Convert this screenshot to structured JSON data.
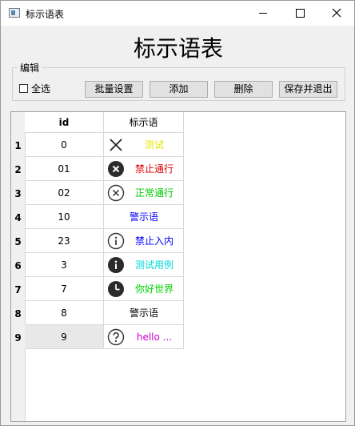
{
  "window": {
    "title": "标示语表",
    "controls": {
      "minimize": "minimize",
      "maximize": "maximize",
      "close": "close"
    }
  },
  "heading": "标示语表",
  "edit_group": {
    "title": "编辑",
    "select_all_label": "全选",
    "select_all_checked": false,
    "buttons": {
      "batch_settings": "批量设置",
      "add": "添加",
      "delete": "删除",
      "save_exit": "保存并退出"
    }
  },
  "table": {
    "columns": [
      "id",
      "标示语"
    ],
    "selected_row": 9,
    "rows": [
      {
        "num": "1",
        "id": "0",
        "text": "测试",
        "icon": "x-mark-icon",
        "color": "#e6e600"
      },
      {
        "num": "2",
        "id": "01",
        "text": "禁止通行",
        "icon": "filled-x-circle-icon",
        "color": "#e00000"
      },
      {
        "num": "3",
        "id": "02",
        "text": "正常通行",
        "icon": "outline-x-circle-icon",
        "color": "#00c800"
      },
      {
        "num": "4",
        "id": "10",
        "text": "警示语",
        "icon": "",
        "color": "#0000ff"
      },
      {
        "num": "5",
        "id": "23",
        "text": "禁止入内",
        "icon": "info-outline-icon",
        "color": "#0000ff"
      },
      {
        "num": "6",
        "id": "3",
        "text": "测试用例",
        "icon": "info-filled-icon",
        "color": "#00d8d8"
      },
      {
        "num": "7",
        "id": "7",
        "text": "你好世界",
        "icon": "clock-filled-icon",
        "color": "#00d000"
      },
      {
        "num": "8",
        "id": "8",
        "text": "警示语",
        "icon": "",
        "color": "#000000"
      },
      {
        "num": "9",
        "id": "9",
        "text": "hello ...",
        "icon": "question-outline-icon",
        "color": "#cc00cc"
      }
    ]
  }
}
